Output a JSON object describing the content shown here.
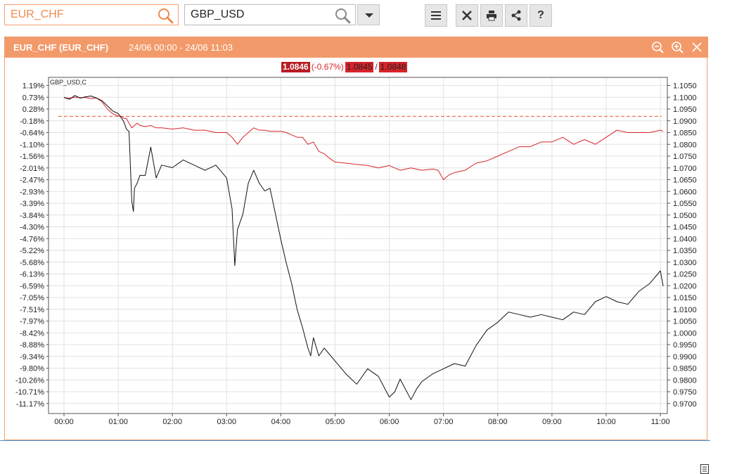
{
  "toolbar": {
    "symbol1_value": "EUR_CHF",
    "symbol2_value": "GBP_USD",
    "buttons": [
      {
        "name": "layout-icon",
        "label": ""
      },
      {
        "name": "tools-icon",
        "label": ""
      },
      {
        "name": "print-icon",
        "label": ""
      },
      {
        "name": "share-icon",
        "label": ""
      },
      {
        "name": "help-icon",
        "label": "?"
      }
    ]
  },
  "panel": {
    "title": "EUR_CHF (EUR_CHF)",
    "range": "24/06 00:00 - 24/06 11:03",
    "header_color": "#f39a6a"
  },
  "quote": {
    "last": "1.0846",
    "change": "(-0.67%)",
    "bid": "1.0845",
    "separator": "/",
    "ask": "1.0848"
  },
  "chart_data": {
    "type": "line",
    "overlay_label": "GBP_USD,C",
    "x_ticks": [
      "00:00",
      "01:00",
      "02:00",
      "03:00",
      "04:00",
      "05:00",
      "06:00",
      "07:00",
      "08:00",
      "09:00",
      "10:00",
      "11:00"
    ],
    "left_axis_ticks": [
      "1.19%",
      "0.73%",
      "0.28%",
      "-0.18%",
      "-0.64%",
      "-1.10%",
      "-1.56%",
      "-2.01%",
      "-2.47%",
      "-2.93%",
      "-3.39%",
      "-3.84%",
      "-4.30%",
      "-4.76%",
      "-5.22%",
      "-5.68%",
      "-6.13%",
      "-6.59%",
      "-7.05%",
      "-7.51%",
      "-7.97%",
      "-8.42%",
      "-8.88%",
      "-9.34%",
      "-9.80%",
      "-10.26%",
      "-10.71%",
      "-11.17%"
    ],
    "right_axis_ticks": [
      "1.1050",
      "1.1000",
      "1.0950",
      "1.0900",
      "1.0850",
      "1.0800",
      "1.0750",
      "1.0700",
      "1.0650",
      "1.0600",
      "1.0550",
      "1.0500",
      "1.0450",
      "1.0400",
      "1.0350",
      "1.0300",
      "1.0250",
      "1.0200",
      "1.0150",
      "1.0100",
      "1.0050",
      "1.0000",
      "0.9950",
      "0.9900",
      "0.9850",
      "0.9800",
      "0.9750",
      "0.9700"
    ],
    "reference_line": {
      "value": 1.0919,
      "color": "#e05a3a"
    },
    "series": [
      {
        "name": "EUR_CHF",
        "color": "#d8232a",
        "axis": "right",
        "x": [
          0,
          0.1,
          0.2,
          0.3,
          0.4,
          0.5,
          0.6,
          0.7,
          0.8,
          0.9,
          1.0,
          1.05,
          1.1,
          1.15,
          1.2,
          1.25,
          1.3,
          1.35,
          1.4,
          1.5,
          1.6,
          1.7,
          1.8,
          2.0,
          2.2,
          2.4,
          2.6,
          2.8,
          3.0,
          3.1,
          3.2,
          3.3,
          3.4,
          3.5,
          3.6,
          3.7,
          3.8,
          3.9,
          4.0,
          4.1,
          4.2,
          4.3,
          4.4,
          4.5,
          4.6,
          4.7,
          4.8,
          4.9,
          5.0,
          5.2,
          5.4,
          5.6,
          5.8,
          6.0,
          6.2,
          6.4,
          6.6,
          6.8,
          6.9,
          7.0,
          7.1,
          7.2,
          7.4,
          7.6,
          7.8,
          8.0,
          8.2,
          8.4,
          8.6,
          8.8,
          9.0,
          9.2,
          9.4,
          9.6,
          9.8,
          10.0,
          10.2,
          10.4,
          10.6,
          10.8,
          11.0,
          11.05
        ],
        "y": [
          1.0998,
          1.0996,
          1.1,
          1.0998,
          1.0999,
          1.0994,
          1.0997,
          1.098,
          1.095,
          1.093,
          1.092,
          1.092,
          1.091,
          1.091,
          1.089,
          1.087,
          1.088,
          1.089,
          1.088,
          1.0875,
          1.088,
          1.087,
          1.087,
          1.0865,
          1.087,
          1.086,
          1.086,
          1.085,
          1.085,
          1.083,
          1.08,
          1.083,
          1.085,
          1.087,
          1.086,
          1.086,
          1.0855,
          1.0855,
          1.0855,
          1.085,
          1.084,
          1.083,
          1.083,
          1.08,
          1.081,
          1.077,
          1.076,
          1.074,
          1.0725,
          1.072,
          1.0715,
          1.071,
          1.07,
          1.071,
          1.069,
          1.07,
          1.069,
          1.0695,
          1.069,
          1.065,
          1.067,
          1.068,
          1.069,
          1.072,
          1.073,
          1.075,
          1.077,
          1.079,
          1.079,
          1.081,
          1.081,
          1.083,
          1.08,
          1.082,
          1.08,
          1.083,
          1.086,
          1.085,
          1.085,
          1.085,
          1.086,
          1.0855
        ]
      },
      {
        "name": "GBP_USD,C",
        "color": "#111111",
        "axis": "left",
        "x": [
          0,
          0.1,
          0.2,
          0.3,
          0.4,
          0.5,
          0.6,
          0.7,
          0.8,
          0.9,
          1.0,
          1.1,
          1.15,
          1.2,
          1.25,
          1.28,
          1.3,
          1.35,
          1.4,
          1.5,
          1.6,
          1.7,
          1.8,
          2.0,
          2.2,
          2.4,
          2.6,
          2.8,
          3.0,
          3.1,
          3.15,
          3.2,
          3.3,
          3.4,
          3.5,
          3.6,
          3.7,
          3.8,
          4.0,
          4.1,
          4.2,
          4.3,
          4.4,
          4.5,
          4.55,
          4.6,
          4.7,
          4.8,
          5.0,
          5.2,
          5.4,
          5.6,
          5.8,
          6.0,
          6.1,
          6.2,
          6.4,
          6.5,
          6.6,
          6.8,
          7.0,
          7.2,
          7.4,
          7.6,
          7.8,
          8.0,
          8.2,
          8.4,
          8.6,
          8.8,
          9.0,
          9.2,
          9.4,
          9.6,
          9.8,
          10.0,
          10.2,
          10.4,
          10.6,
          10.8,
          11.0,
          11.05
        ],
        "y": [
          0.73,
          0.65,
          0.8,
          0.7,
          0.75,
          0.78,
          0.7,
          0.6,
          0.4,
          0.2,
          0.1,
          -0.2,
          -0.5,
          -0.6,
          -3.3,
          -3.7,
          -2.8,
          -2.6,
          -2.3,
          -2.3,
          -1.2,
          -2.4,
          -1.9,
          -2.0,
          -1.7,
          -1.9,
          -2.1,
          -1.9,
          -2.4,
          -3.6,
          -5.8,
          -4.4,
          -3.8,
          -2.6,
          -2.1,
          -2.6,
          -2.9,
          -2.8,
          -4.8,
          -5.7,
          -6.5,
          -7.5,
          -8.2,
          -9.0,
          -9.3,
          -8.6,
          -9.3,
          -9.0,
          -9.5,
          -10.0,
          -10.4,
          -9.8,
          -10.1,
          -10.9,
          -10.7,
          -10.2,
          -11.0,
          -10.6,
          -10.3,
          -10.0,
          -9.8,
          -9.6,
          -9.7,
          -8.9,
          -8.3,
          -8.0,
          -7.6,
          -7.7,
          -7.8,
          -7.7,
          -7.8,
          -7.9,
          -7.6,
          -7.7,
          -7.2,
          -7.0,
          -7.2,
          -7.3,
          -6.8,
          -6.5,
          -6.0,
          -6.6
        ]
      }
    ],
    "grid": true
  }
}
